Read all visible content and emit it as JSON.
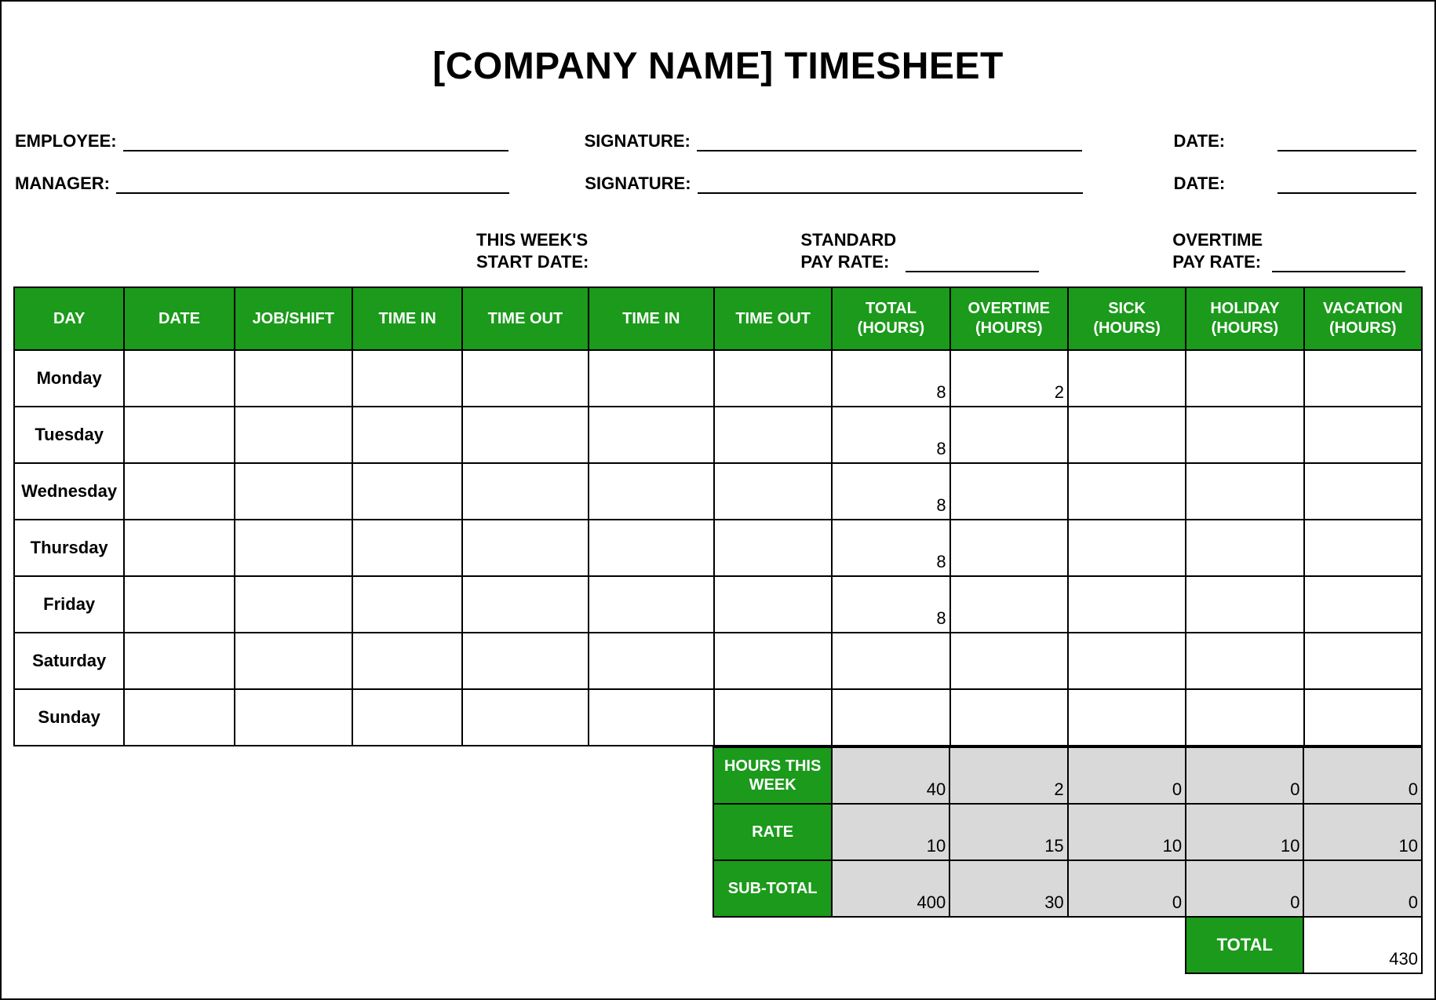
{
  "title": "[COMPANY NAME] TIMESHEET",
  "labels": {
    "employee": "EMPLOYEE:",
    "manager": "MANAGER:",
    "signature": "SIGNATURE:",
    "date": "DATE:",
    "this_weeks": "THIS WEEK'S",
    "start_date": "START DATE:",
    "standard": "STANDARD",
    "pay_rate": "PAY RATE:",
    "overtime": "OVERTIME"
  },
  "columns": {
    "day": "DAY",
    "date": "DATE",
    "job": "JOB/SHIFT",
    "time_in1": "TIME IN",
    "time_out1": "TIME OUT",
    "time_in2": "TIME IN",
    "time_out2": "TIME OUT",
    "total": "TOTAL (HOURS)",
    "ot": "OVERTIME (HOURS)",
    "sick": "SICK (HOURS)",
    "holiday": "HOLIDAY (HOURS)",
    "vacation": "VACATION (HOURS)"
  },
  "rows": [
    {
      "day": "Monday",
      "total": "8",
      "ot": "2",
      "sick": "",
      "holiday": "",
      "vacation": ""
    },
    {
      "day": "Tuesday",
      "total": "8",
      "ot": "",
      "sick": "",
      "holiday": "",
      "vacation": ""
    },
    {
      "day": "Wednesday",
      "total": "8",
      "ot": "",
      "sick": "",
      "holiday": "",
      "vacation": ""
    },
    {
      "day": "Thursday",
      "total": "8",
      "ot": "",
      "sick": "",
      "holiday": "",
      "vacation": ""
    },
    {
      "day": "Friday",
      "total": "8",
      "ot": "",
      "sick": "",
      "holiday": "",
      "vacation": ""
    },
    {
      "day": "Saturday",
      "total": "",
      "ot": "",
      "sick": "",
      "holiday": "",
      "vacation": ""
    },
    {
      "day": "Sunday",
      "total": "",
      "ot": "",
      "sick": "",
      "holiday": "",
      "vacation": ""
    }
  ],
  "summary": {
    "labels": {
      "hours_this_week": "HOURS THIS WEEK",
      "rate": "RATE",
      "subtotal": "SUB-TOTAL",
      "total": "TOTAL"
    },
    "hours": {
      "total": "40",
      "ot": "2",
      "sick": "0",
      "holiday": "0",
      "vacation": "0"
    },
    "rate": {
      "total": "10",
      "ot": "15",
      "sick": "10",
      "holiday": "10",
      "vacation": "10"
    },
    "subtotal": {
      "total": "400",
      "ot": "30",
      "sick": "0",
      "holiday": "0",
      "vacation": "0"
    },
    "grand_total": "430"
  },
  "colors": {
    "header_green": "#1b9a1b",
    "summary_gray": "#d9d9d9"
  }
}
